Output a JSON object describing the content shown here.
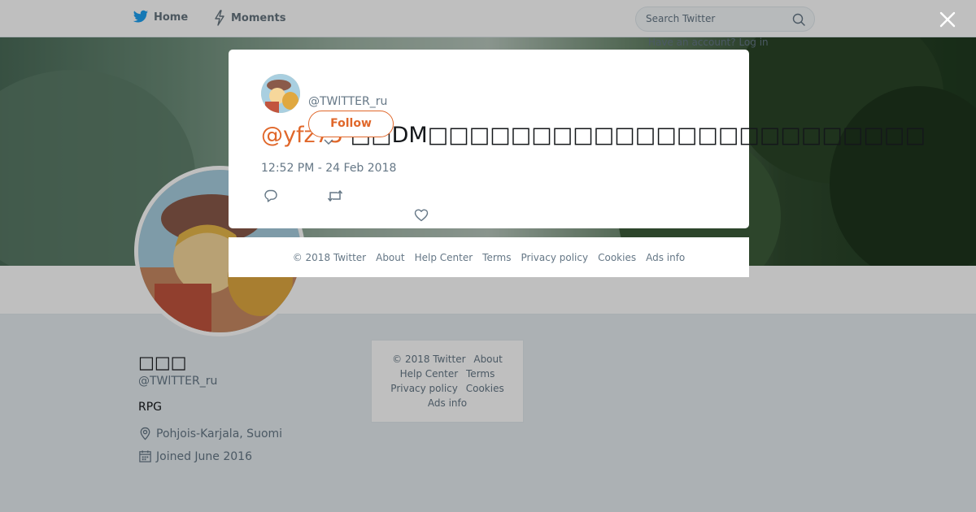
{
  "nav": {
    "home_label": "Home",
    "moments_label": "Moments",
    "search_placeholder": "Search Twitter",
    "login_prompt": "Have an account? Log in"
  },
  "profile": {
    "name": "□□□",
    "handle": "@TWlTTER_ru",
    "bio": "RPG",
    "location": "Pohjois-Karjala, Suomi",
    "joined": "Joined June 2016"
  },
  "side_footer": {
    "links": [
      "© 2018 Twitter",
      "About",
      "Help Center",
      "Terms",
      "Privacy policy",
      "Cookies",
      "Ads info"
    ]
  },
  "tweet": {
    "handle": "@TWlTTER_ru",
    "follow_label": "Follow",
    "mention": "@yfz75",
    "body": " □□DM□□□□□□□□□□□□□□□□□□□□□□□□",
    "timestamp": "12:52 PM - 24 Feb 2018"
  },
  "modal_footer": {
    "links": [
      "© 2018 Twitter",
      "About",
      "Help Center",
      "Terms",
      "Privacy policy",
      "Cookies",
      "Ads info"
    ]
  },
  "colors": {
    "accent": "#e0672a",
    "twitter_blue": "#1da1f2",
    "muted_text": "#657786",
    "page_bg": "#e6ecf0"
  },
  "icons": {
    "home": "twitter-bird-icon",
    "moments": "lightning-icon",
    "search": "search-icon",
    "close": "close-icon",
    "reply": "reply-icon",
    "retweet": "retweet-icon",
    "like": "heart-icon",
    "location": "location-pin-icon",
    "joined": "calendar-icon"
  }
}
